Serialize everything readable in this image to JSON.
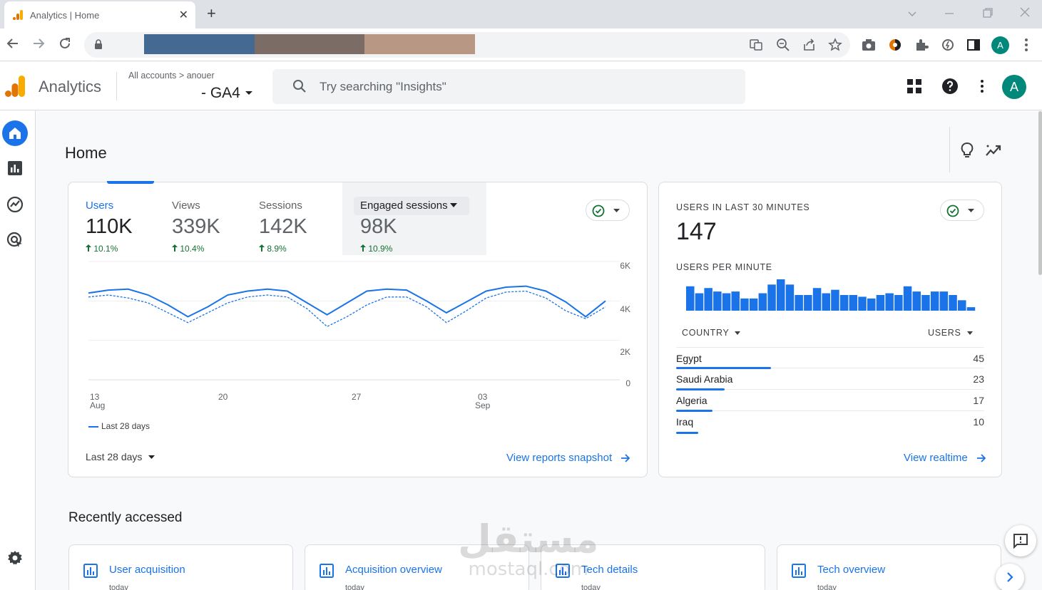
{
  "browser": {
    "tab_title": "Analytics | Home",
    "close_glyph": "✕",
    "new_tab_glyph": "+",
    "profile_initial": "A",
    "redaction_colors": [
      "#446a94",
      "#7c6c66",
      "#b89884"
    ]
  },
  "header": {
    "brand": "Analytics",
    "breadcrumb_root": "All accounts",
    "breadcrumb_sep": ">",
    "breadcrumb_account": "anouer",
    "property": "- GA4",
    "search_placeholder": "Try searching \"Insights\"",
    "avatar_initial": "A"
  },
  "page": {
    "title": "Home"
  },
  "overview_card": {
    "metrics": [
      {
        "name": "Users",
        "value": "110K",
        "change": "10.1%"
      },
      {
        "name": "Views",
        "value": "339K",
        "change": "10.4%"
      },
      {
        "name": "Sessions",
        "value": "142K",
        "change": "8.9%"
      },
      {
        "name": "Engaged sessions",
        "value": "98K",
        "change": "10.9%"
      }
    ],
    "legend": "Last 28 days",
    "date_range": "Last 28 days",
    "link": "View reports snapshot",
    "y_ticks": [
      "6K",
      "4K",
      "2K",
      "0"
    ],
    "x_ticks": [
      {
        "day": "13",
        "month": "Aug"
      },
      {
        "day": "20",
        "month": ""
      },
      {
        "day": "27",
        "month": ""
      },
      {
        "day": "03",
        "month": "Sep"
      }
    ]
  },
  "chart_data": {
    "type": "line",
    "ylim": [
      0,
      6000
    ],
    "y_ticks": [
      "6K",
      "4K",
      "2K",
      "0"
    ],
    "x_ticks": [
      "13 Aug",
      "20",
      "27",
      "03 Sep"
    ],
    "series": [
      {
        "name": "Last 28 days",
        "style": "solid",
        "values": [
          4400,
          4550,
          4600,
          4300,
          3800,
          3200,
          3700,
          4300,
          4500,
          4600,
          4500,
          3900,
          3300,
          3900,
          4500,
          4600,
          4550,
          4000,
          3400,
          3950,
          4500,
          4700,
          4750,
          4500,
          3950,
          3200,
          4000
        ]
      },
      {
        "style": "dashed",
        "values": [
          4200,
          4300,
          4150,
          3900,
          3400,
          2900,
          3400,
          3900,
          4200,
          4300,
          4200,
          3600,
          2700,
          3200,
          3800,
          4200,
          4200,
          3700,
          2900,
          3500,
          4150,
          4450,
          4500,
          4150,
          3500,
          3100,
          3700
        ]
      }
    ]
  },
  "realtime_card": {
    "title": "USERS IN LAST 30 MINUTES",
    "value": "147",
    "subtitle": "USERS PER MINUTE",
    "per_minute": [
      14,
      10,
      13,
      11,
      10,
      11,
      7,
      7,
      10,
      15,
      18,
      15,
      9,
      9,
      13,
      10,
      12,
      9,
      9,
      8,
      7,
      9,
      10,
      9,
      14,
      11,
      9,
      11,
      11,
      9,
      6,
      2
    ],
    "col_country": "COUNTRY",
    "col_users": "USERS",
    "countries": [
      {
        "name": "Egypt",
        "users": "45",
        "share": 1.0
      },
      {
        "name": "Saudi Arabia",
        "users": "23",
        "share": 0.51
      },
      {
        "name": "Algeria",
        "users": "17",
        "share": 0.38
      },
      {
        "name": "Iraq",
        "users": "10",
        "share": 0.23
      }
    ],
    "link": "View realtime"
  },
  "recent": {
    "title": "Recently accessed",
    "items": [
      {
        "label": "User acquisition",
        "sub": "today"
      },
      {
        "label": "Acquisition overview",
        "sub": "today"
      },
      {
        "label": "Tech details",
        "sub": "today"
      },
      {
        "label": "Tech overview",
        "sub": "today"
      }
    ]
  },
  "watermark": {
    "line1": "مستقل",
    "line2": "mostaql.com"
  },
  "colors": {
    "accent": "#1a73e8",
    "positive": "#137333",
    "logo_orange": "#f9ab00",
    "logo_dark": "#e37400"
  }
}
